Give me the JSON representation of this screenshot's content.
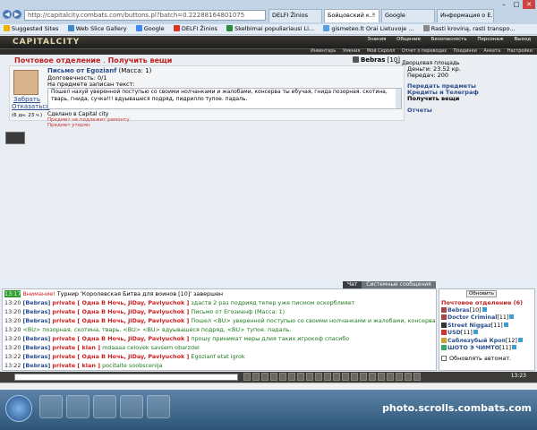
{
  "browser": {
    "url": "http://capitalcity.combats.com/buttons.pl?batch=0.22288164801075",
    "tabs": [
      {
        "title": "DELFI Žinios",
        "active": false
      },
      {
        "title": "Бойцовский к...",
        "active": true
      },
      {
        "title": "Google",
        "active": false
      },
      {
        "title": "Информация о E...",
        "active": false
      }
    ],
    "favorites": [
      "Suggested Sites",
      "Web Slice Gallery",
      "Google",
      "DELFI Žinios",
      "Skelbimai populiariausi Li...",
      "gismeteo.lt Orai Lietuvoje ...",
      "Rasti kroviną, rasti transpo..."
    ]
  },
  "game": {
    "logo": "CAPITALCITY",
    "top_menu": [
      "Знания",
      "Общение",
      "Безопасность",
      "Персонаж",
      "Выход"
    ],
    "sub_menu": [
      "Инвентарь",
      "Умения",
      "Мой Скролл",
      "Отчет о переводах",
      "Поединки",
      "Анкета",
      "Настройки"
    ]
  },
  "page": {
    "title_left": "Почтовое отделение",
    "title_sep": ".",
    "title_right": "Получить вещи",
    "user_name": "Bebras",
    "user_level": "[10]",
    "district": "Дворцовая площадь"
  },
  "letter": {
    "title_prefix": "Письмо от",
    "title_sender": "Egozianf",
    "title_mass": "(Масса: 1)",
    "debt": "Долговечность: 0/1",
    "item_text_label": "На предмете записан текст:",
    "text": "Пошел нахуй уверенной поступью со своими нолчанками и жалобами, консерва ты ебучая, гнида позорная. скотина, тварь, гнида, сучка!!! вдуывашеся подряд, пидрилло тупое. падаль.",
    "pick_button": "Забрать",
    "refuse_button": "Отказаться",
    "deadline": "(6 дн. 23 ч.)",
    "made_in": "Сделано в Capital city",
    "red_note1": "Предмет не подлежит ремонту",
    "red_note2": "Предмет утерян"
  },
  "stats": {
    "money": "Деньги: 23.52 кр.",
    "transfer": "Передач: 200"
  },
  "links": [
    "Передать предметы",
    "Кредиты и Телеграф",
    "Получить вещи",
    "Отчеты"
  ],
  "chat_tabs": [
    "Чат",
    "Системные сообщения"
  ],
  "chat": [
    {
      "time": "13:17",
      "sys": "Внимание!",
      "text": " Турнир 'Королевская Битва для воинов [10]' завершен"
    },
    {
      "time": "13:20",
      "nick": "[Bebras]",
      "priv": "private [ Одна В Ночь, JiDay, Pavlyuchok ]",
      "text": "здаств 2 раз подрияд тепер уже писмом оскорблияет"
    },
    {
      "time": "13:20",
      "nick": "[Bebras]",
      "priv": "private [ Одна В Ночь, JiDay, Pavlyuchok ]",
      "text": "Письмо от Егозианф (Масса: 1)"
    },
    {
      "time": "13:20",
      "nick": "[Bebras]",
      "priv": "private [ Одна В Ночь, JiDay, Pavlyuchok ]",
      "text": "Пошел <BU> уверенной поступью со своими нолчанками и жалобами, консерва ты <BU>"
    },
    {
      "time": "13:20",
      "nick": "",
      "priv": "",
      "text": "<BU> позорная. скотина, тварь, <BU> <BU> вдуывашеся подряд, <BU> тупое. падаль."
    },
    {
      "time": "13:20",
      "nick": "[Bebras]",
      "priv": "private [ Одна В Ночь, JiDay, Pavlyuchok ]",
      "text": "прошу принимат меры длия таких игрокоф спасибо"
    },
    {
      "time": "13:20",
      "nick": "[Bebras]",
      "priv": "private [ klan ]",
      "text": "mdaaaa celovek savsem obarzdel"
    },
    {
      "time": "13:22",
      "nick": "[Bebras]",
      "priv": "private [ Одна В Ночь, JiDay, Pavlyuchok ]",
      "text": "Egozianf etat igrok"
    },
    {
      "time": "13:22",
      "nick": "[Bebras]",
      "priv": "private [ klan ]",
      "text": "pocitaite soobscenija"
    }
  ],
  "side": {
    "refresh": "Обновить",
    "header": "Почтовое отделение (6)",
    "people": [
      {
        "name": "Bebras",
        "level": "[10]"
      },
      {
        "name": "Doctor Criminal",
        "level": "[11]"
      },
      {
        "name": "Street Niggaz",
        "level": "[11]"
      },
      {
        "name": "USD",
        "level": "[11]"
      },
      {
        "name": "Саблезубый Кроп",
        "level": "[12]"
      },
      {
        "name": "ШОТО Э ЧИМТО",
        "level": "[11]"
      }
    ],
    "auto_refresh": "Обновлять автомат."
  },
  "clock": "13:23",
  "watermark": "photo.scrolls.combats.com"
}
